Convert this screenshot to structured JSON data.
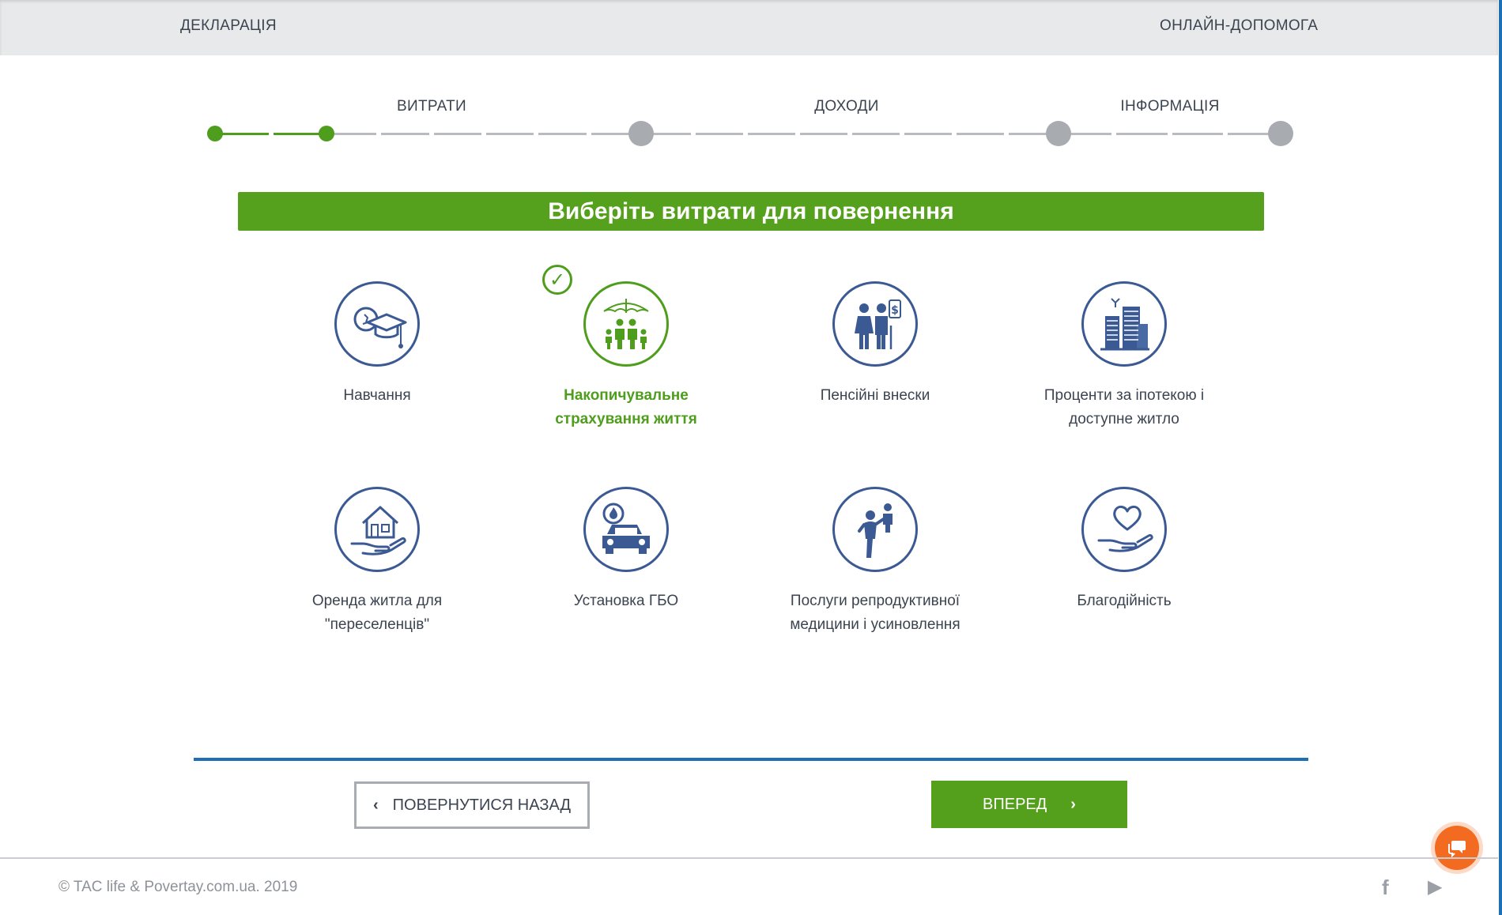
{
  "header": {
    "left_link": "ДЕКЛАРАЦІЯ",
    "right_link": "ОНЛАЙН-ДОПОМОГА"
  },
  "steps": {
    "labels": [
      "ВИТРАТИ",
      "ДОХОДИ",
      "ІНФОРМАЦІЯ"
    ],
    "completed_substeps": 2
  },
  "banner": {
    "title": "Виберіть витрати для повернення"
  },
  "expenses": [
    {
      "label": "Навчання",
      "icon": "graduation-cap-icon",
      "selected": false
    },
    {
      "label": "Накопичувальне страхування життя",
      "icon": "family-umbrella-icon",
      "selected": true
    },
    {
      "label": "Пенсійні внески",
      "icon": "elderly-couple-icon",
      "selected": false
    },
    {
      "label": "Проценти за іпотекою і доступне житло",
      "icon": "buildings-icon",
      "selected": false
    },
    {
      "label": "Оренда житла для \"переселенців\"",
      "icon": "house-in-hand-icon",
      "selected": false
    },
    {
      "label": "Установка ГБО",
      "icon": "gas-car-icon",
      "selected": false
    },
    {
      "label": "Послуги репродуктивної медицини і усиновлення",
      "icon": "parent-child-icon",
      "selected": false
    },
    {
      "label": "Благодійність",
      "icon": "heart-in-hand-icon",
      "selected": false
    }
  ],
  "buttons": {
    "back": "ПОВЕРНУТИСЯ НАЗАД",
    "next": "ВПЕРЕД"
  },
  "footer": {
    "copyright": "© TAC life & Povertay.com.ua. 2019"
  },
  "colors": {
    "accent_green": "#55a01c",
    "icon_blue": "#3b5a94",
    "divider_blue": "#1f6fb5",
    "chat_orange": "#f36b21"
  }
}
